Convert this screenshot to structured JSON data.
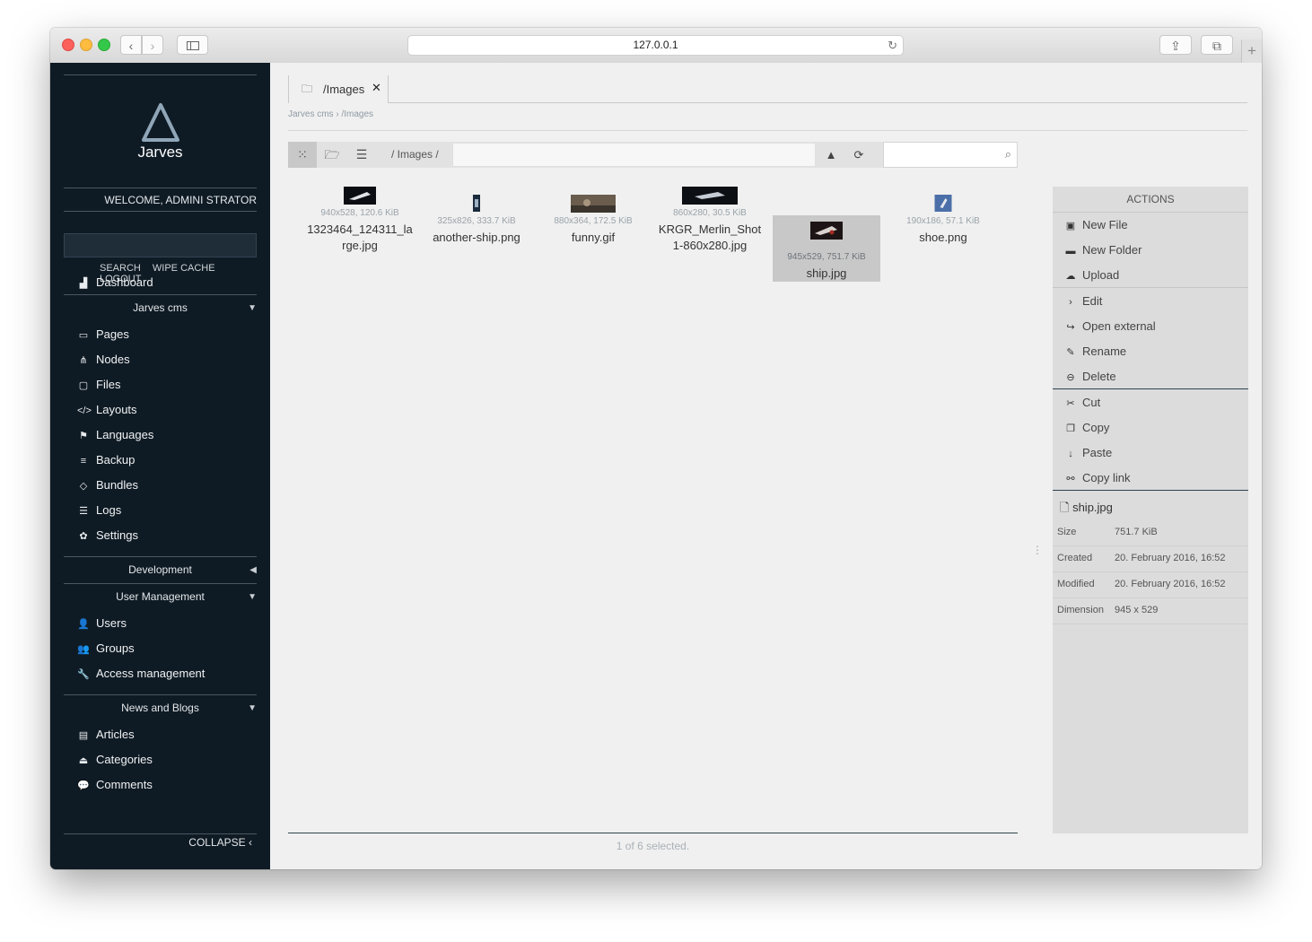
{
  "browser": {
    "url": "127.0.0.1"
  },
  "sidebar": {
    "logo_text": "Jarves",
    "welcome": "WELCOME, ADMINI STRATOR",
    "links": [
      "SEARCH",
      "WIPE CACHE",
      "LOGOUT"
    ],
    "dashboard": "Dashboard",
    "sections": [
      {
        "title": "Jarves cms",
        "items": [
          "Pages",
          "Nodes",
          "Files",
          "Layouts",
          "Languages",
          "Backup",
          "Bundles",
          "Logs",
          "Settings"
        ]
      },
      {
        "title": "Development",
        "items": []
      },
      {
        "title": "User Management",
        "items": [
          "Users",
          "Groups",
          "Access management"
        ]
      },
      {
        "title": "News and Blogs",
        "items": [
          "Articles",
          "Categories",
          "Comments"
        ]
      }
    ],
    "collapse": "COLLAPSE"
  },
  "main": {
    "tab_label": "/Images",
    "breadcrumb": "Jarves cms › /Images",
    "path_label": "/   Images /",
    "files": [
      {
        "meta": "940x528, 120.6 KiB",
        "name": "1323464_124311_large.jpg",
        "selected": false
      },
      {
        "meta": "325x826, 333.7 KiB",
        "name": "another-ship.png",
        "selected": false
      },
      {
        "meta": "880x364, 172.5 KiB",
        "name": "funny.gif",
        "selected": false
      },
      {
        "meta": "860x280, 30.5 KiB",
        "name": "KRGR_Merlin_Shot1-860x280.jpg",
        "selected": false
      },
      {
        "meta": "945x529, 751.7 KiB",
        "name": "ship.jpg",
        "selected": true
      },
      {
        "meta": "190x186, 57.1 KiB",
        "name": "shoe.png",
        "selected": false
      }
    ],
    "status": "1 of 6 selected."
  },
  "actions": {
    "title": "ACTIONS",
    "group1": [
      "New File",
      "New Folder",
      "Upload"
    ],
    "group2": [
      "Edit",
      "Open external",
      "Rename",
      "Delete"
    ],
    "group3": [
      "Cut",
      "Copy",
      "Paste",
      "Copy link"
    ]
  },
  "info": {
    "file": "ship.jpg",
    "rows": [
      {
        "key": "Size",
        "value": "751.7 KiB"
      },
      {
        "key": "Created",
        "value": "20. February 2016, 16:52"
      },
      {
        "key": "Modified",
        "value": "20. February 2016, 16:52"
      },
      {
        "key": "Dimension",
        "value": "945 x 529"
      }
    ]
  },
  "colors": {
    "sidebar_bg": "#0f1b24",
    "main_bg": "#f0f0f0",
    "selected_bg": "#c8c8c8",
    "accent_rule": "#2f4451"
  }
}
